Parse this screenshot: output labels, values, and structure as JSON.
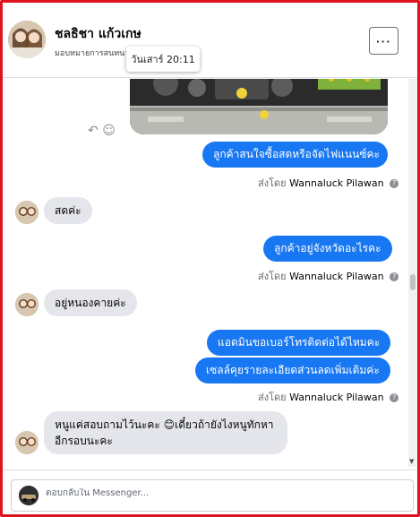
{
  "header": {
    "contact_name": "ชลธิชา แก้วเกษ",
    "subtitle": "มอบหมายการสนทนา",
    "more_label": "···",
    "tooltip": "วันเสาร์ 20:11"
  },
  "messages": [
    {
      "dir": "out",
      "text": "ลูกค้าสนใจซื้อสดหรือจัดไฟแนนซ์คะ"
    },
    {
      "dir": "meta",
      "prefix": "ส่งโดย",
      "sender": "Wannaluck Pilawan"
    },
    {
      "dir": "in",
      "text": "สดค่ะ"
    },
    {
      "dir": "out",
      "text": "ลูกค้าอยู่จังหวัดอะไรคะ"
    },
    {
      "dir": "meta",
      "prefix": "ส่งโดย",
      "sender": "Wannaluck Pilawan"
    },
    {
      "dir": "in",
      "text": "อยู่หนองคายค่ะ"
    },
    {
      "dir": "out",
      "text": "แอดมินขอเบอร์โทรติดต่อได้ไหมคะ"
    },
    {
      "dir": "out",
      "text": "เซลล์คุยรายละเอียดส่วนลดเพิ่มเติมค่ะ"
    },
    {
      "dir": "meta",
      "prefix": "ส่งโดย",
      "sender": "Wannaluck Pilawan"
    },
    {
      "dir": "in",
      "text_line1": "หนูแค่สอบถามไว้นะคะ 😊เดี๋ยวถ้ายังไงหนูทักหา",
      "text_line2": "อีกรอบนะคะ"
    }
  ],
  "icons": {
    "reply": "reply-icon",
    "emoji": "smiley-icon",
    "info": "info-icon"
  },
  "composer": {
    "placeholder": "ตอบกลับใน Messenger..."
  },
  "colors": {
    "outgoing_bubble": "#1877f2",
    "incoming_bubble": "#e4e6eb",
    "frame_border": "#e0141e"
  }
}
